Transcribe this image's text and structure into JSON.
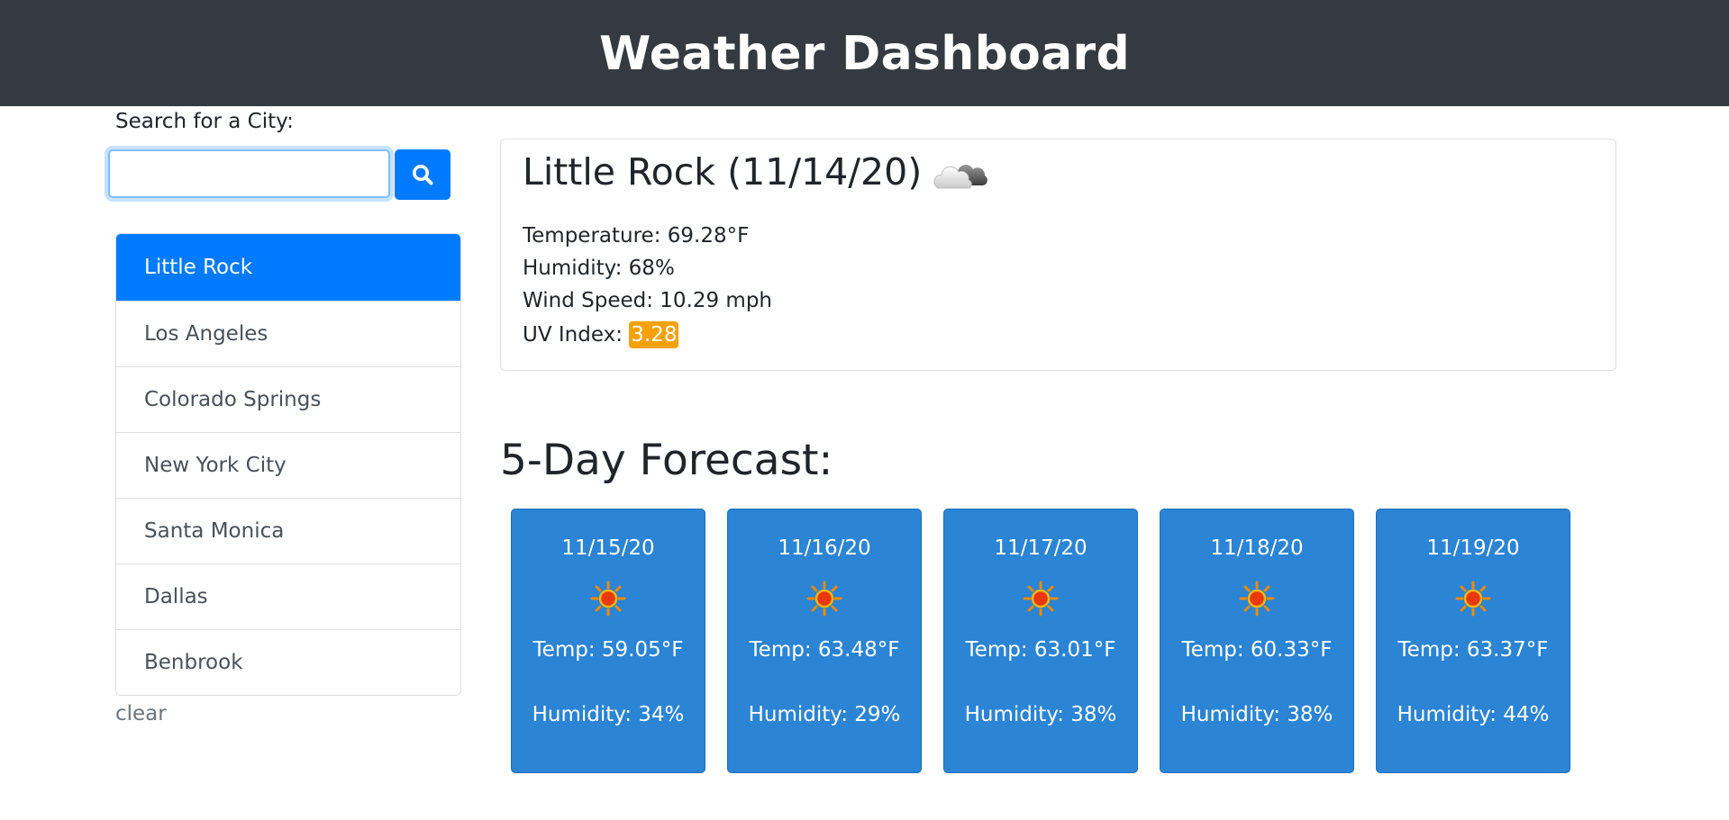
{
  "header": {
    "title": "Weather Dashboard"
  },
  "search": {
    "label": "Search for a City:",
    "value": "",
    "placeholder": "",
    "button_icon": "search-icon"
  },
  "cities": [
    {
      "name": "Little Rock",
      "active": true
    },
    {
      "name": "Los Angeles",
      "active": false
    },
    {
      "name": "Colorado Springs",
      "active": false
    },
    {
      "name": "New York City",
      "active": false
    },
    {
      "name": "Santa Monica",
      "active": false
    },
    {
      "name": "Dallas",
      "active": false
    },
    {
      "name": "Benbrook",
      "active": false
    }
  ],
  "clear_label": "clear",
  "current": {
    "title": "Little Rock (11/14/20)",
    "icon": "partly-cloudy-icon",
    "temperature": "Temperature: 69.28°F",
    "humidity": "Humidity: 68%",
    "wind": "Wind Speed: 10.29 mph",
    "uv_label": "UV Index: ",
    "uv_value": "3.28"
  },
  "forecast": {
    "heading": "5-Day Forecast:",
    "days": [
      {
        "date": "11/15/20",
        "icon": "sun-icon",
        "temp": "Temp: 59.05°F",
        "humidity": "Humidity: 34%"
      },
      {
        "date": "11/16/20",
        "icon": "sun-icon",
        "temp": "Temp: 63.48°F",
        "humidity": "Humidity: 29%"
      },
      {
        "date": "11/17/20",
        "icon": "sun-icon",
        "temp": "Temp: 63.01°F",
        "humidity": "Humidity: 38%"
      },
      {
        "date": "11/18/20",
        "icon": "sun-icon",
        "temp": "Temp: 60.33°F",
        "humidity": "Humidity: 38%"
      },
      {
        "date": "11/19/20",
        "icon": "sun-icon",
        "temp": "Temp: 63.37°F",
        "humidity": "Humidity: 44%"
      }
    ]
  },
  "colors": {
    "header_bg": "#343a40",
    "primary": "#007bff",
    "forecast_card": "#2b84d4",
    "uv_badge": "#f7a10a"
  }
}
